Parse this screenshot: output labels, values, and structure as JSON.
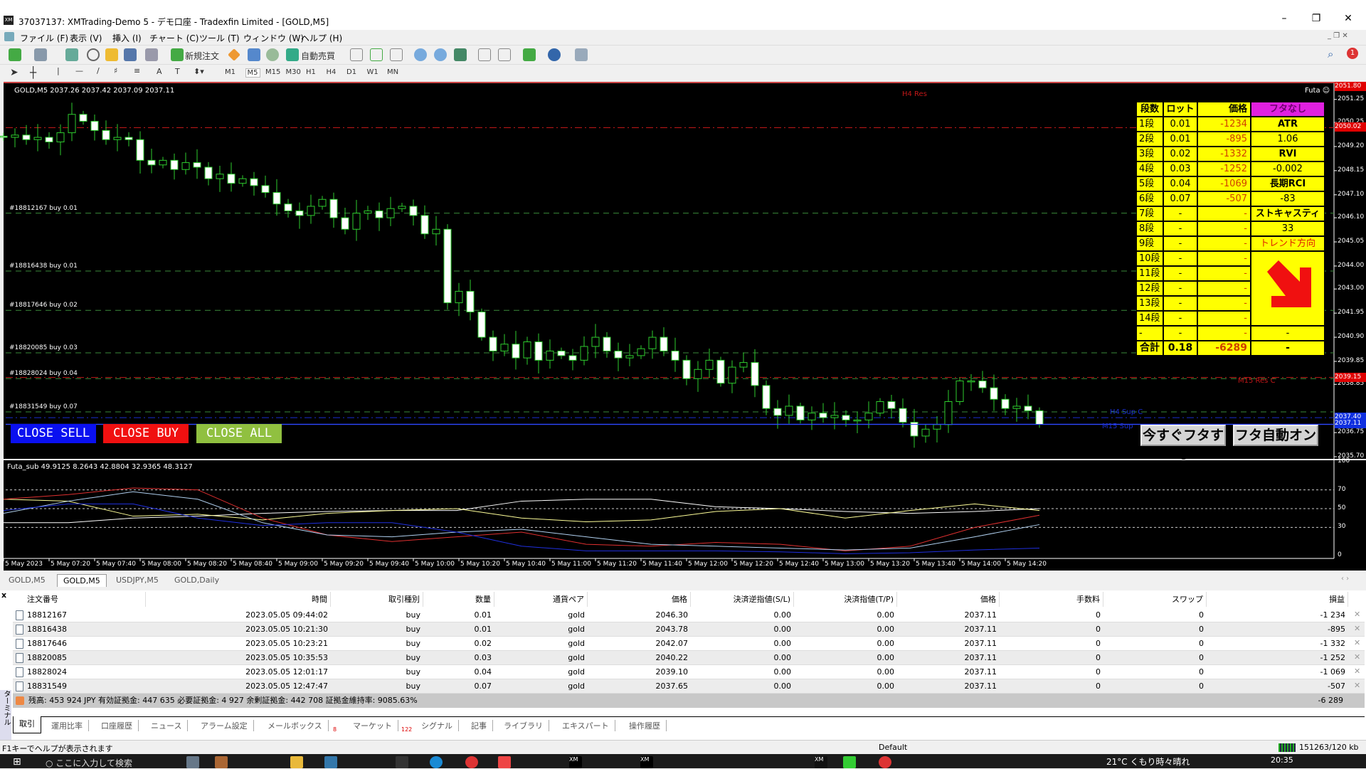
{
  "window": {
    "title": "37037137: XMTrading-Demo 5 - デモ口座 - Tradexfin Limited - [GOLD,M5]",
    "minimize": "–",
    "restore": "❐",
    "close": "✕"
  },
  "menu": [
    "ファイル (F)",
    "表示 (V)",
    "挿入 (I)",
    "チャート (C)",
    "ツール (T)",
    "ウィンドウ (W)",
    "ヘルプ (H)"
  ],
  "toolbar": {
    "new_order": "新規注文",
    "auto_trade": "自動売買",
    "timeframes": [
      "M1",
      "M5",
      "M15",
      "M30",
      "H1",
      "H4",
      "D1",
      "W1",
      "MN"
    ],
    "active_timeframe": "M5",
    "notification_count": "1"
  },
  "chart": {
    "header": "GOLD,M5  2037.26 2037.42 2037.09 2037.11",
    "indicator_name": "Futa",
    "price_axis": [
      "2051.25",
      "2050.25",
      "2049.20",
      "2048.15",
      "2047.10",
      "2046.10",
      "2045.05",
      "2044.00",
      "2043.00",
      "2041.95",
      "2040.90",
      "2039.85",
      "2038.85",
      "2036.75",
      "2035.70"
    ],
    "price_tags": [
      {
        "label": "2051.80",
        "color": "#e00000"
      },
      {
        "label": "2050.02",
        "color": "#e00000"
      },
      {
        "label": "2039.15",
        "color": "#e00000"
      },
      {
        "label": "2037.40",
        "color": "#1030e0"
      },
      {
        "label": "2037.11",
        "color": "#1030e0"
      }
    ],
    "levels": [
      {
        "label": "H4 Res",
        "price": 2050.02,
        "color": "#c01818"
      },
      {
        "label": "M15 Res C",
        "price": 2039.15,
        "color": "#c01818"
      },
      {
        "label": "H4 Sup C",
        "price": 2037.4,
        "color": "#1a2fd0"
      },
      {
        "label": "M15 Sup",
        "price": 2037.11,
        "color": "#1a2fd0"
      }
    ],
    "orders": [
      {
        "label": "#18812167 buy 0.01",
        "price": 2046.3
      },
      {
        "label": "#18816438 buy 0.01",
        "price": 2043.78
      },
      {
        "label": "#18817646 buy 0.02",
        "price": 2042.07
      },
      {
        "label": "#18820085 buy 0.03",
        "price": 2040.22
      },
      {
        "label": "#18828024 buy 0.04",
        "price": 2039.1
      },
      {
        "label": "#18831549 buy 0.07",
        "price": 2037.65
      }
    ],
    "closes": [
      2049.6,
      2049.7,
      2049.5,
      2049.6,
      2049.4,
      2049.8,
      2050.6,
      2050.3,
      2049.9,
      2049.5,
      2049.6,
      2049.5,
      2048.6,
      2048.4,
      2048.6,
      2048.2,
      2048.5,
      2048.3,
      2047.8,
      2048.0,
      2047.6,
      2047.8,
      2047.5,
      2047.2,
      2046.7,
      2046.4,
      2046.2,
      2046.6,
      2046.9,
      2046.1,
      2045.6,
      2046.3,
      2046.4,
      2046.1,
      2046.5,
      2046.6,
      2046.2,
      2045.4,
      2045.6,
      2042.4,
      2042.9,
      2042.0,
      2040.9,
      2040.3,
      2040.6,
      2040.0,
      2040.7,
      2039.9,
      2040.3,
      2040.1,
      2039.9,
      2040.5,
      2040.9,
      2040.3,
      2040.0,
      2040.1,
      2040.4,
      2040.9,
      2040.3,
      2039.9,
      2039.1,
      2039.5,
      2039.9,
      2038.9,
      2039.6,
      2039.8,
      2038.8,
      2037.8,
      2037.5,
      2037.9,
      2037.3,
      2037.6,
      2037.4,
      2037.5,
      2037.3,
      2037.3,
      2037.6,
      2038.1,
      2037.8,
      2037.2,
      2036.6,
      2036.9,
      2037.1,
      2038.1,
      2039.0,
      2039.0,
      2038.7,
      2038.2,
      2037.8,
      2037.9,
      2037.7,
      2037.11
    ],
    "buttons": {
      "close_sell": "CLOSE SELL",
      "close_buy": "CLOSE BUY",
      "close_all": "CLOSE ALL",
      "futa_now": "今すぐフタする",
      "futa_auto": "フタ自動オン"
    },
    "button_colors": {
      "close_sell": "#0a10f0",
      "close_buy": "#f01010",
      "close_all": "#90c040"
    },
    "sub": {
      "header": "Futa_sub 49.9125 8.2643 42.8804 32.9365 48.3127",
      "axis": [
        "100",
        "70",
        "50",
        "30",
        "0"
      ],
      "lines": [
        {
          "color": "#ffffff",
          "values": [
            35,
            35,
            40,
            42,
            45,
            47,
            48,
            48,
            58,
            60,
            60,
            52,
            50,
            47,
            45,
            47,
            50
          ]
        },
        {
          "color": "#ffff99",
          "values": [
            60,
            58,
            42,
            44,
            38,
            45,
            48,
            50,
            40,
            36,
            38,
            47,
            50,
            40,
            48,
            55,
            48
          ]
        },
        {
          "color": "#e03030",
          "values": [
            60,
            65,
            72,
            70,
            40,
            22,
            15,
            20,
            25,
            12,
            10,
            14,
            12,
            5,
            10,
            30,
            43
          ]
        },
        {
          "color": "#b0d0f0",
          "values": [
            45,
            58,
            68,
            60,
            35,
            22,
            20,
            25,
            28,
            20,
            12,
            10,
            8,
            6,
            8,
            20,
            33
          ]
        },
        {
          "color": "#2030e0",
          "values": [
            48,
            55,
            55,
            40,
            32,
            35,
            35,
            25,
            10,
            5,
            5,
            5,
            4,
            2,
            3,
            6,
            8
          ]
        }
      ]
    },
    "time_axis": [
      "5 May 2023",
      "5 May 07:20",
      "5 May 07:40",
      "5 May 08:00",
      "5 May 08:20",
      "5 May 08:40",
      "5 May 09:00",
      "5 May 09:20",
      "5 May 09:40",
      "5 May 10:00",
      "5 May 10:20",
      "5 May 10:40",
      "5 May 11:00",
      "5 May 11:20",
      "5 May 11:40",
      "5 May 12:00",
      "5 May 12:20",
      "5 May 12:40",
      "5 May 13:00",
      "5 May 13:20",
      "5 May 13:40",
      "5 May 14:00",
      "5 May 14:20"
    ]
  },
  "futa_panel": {
    "headers": [
      "段数",
      "ロット",
      "価格",
      "フタなし"
    ],
    "rows": [
      [
        "1段",
        "0.01",
        "-1234",
        "ATR"
      ],
      [
        "2段",
        "0.01",
        "-895",
        "1.06"
      ],
      [
        "3段",
        "0.02",
        "-1332",
        "RVI"
      ],
      [
        "4段",
        "0.03",
        "-1252",
        "-0.002"
      ],
      [
        "5段",
        "0.04",
        "-1069",
        "長期RCI"
      ],
      [
        "6段",
        "0.07",
        "-507",
        "-83"
      ],
      [
        "7段",
        "-",
        "-",
        "ストキャスティクス"
      ],
      [
        "8段",
        "-",
        "-",
        "33"
      ],
      [
        "9段",
        "-",
        "-",
        "トレンド方向"
      ],
      [
        "10段",
        "-",
        "-",
        ""
      ],
      [
        "11段",
        "-",
        "-",
        ""
      ],
      [
        "12段",
        "-",
        "-",
        ""
      ],
      [
        "13段",
        "-",
        "-",
        ""
      ],
      [
        "14段",
        "-",
        "-",
        ""
      ],
      [
        "-",
        "-",
        "-",
        "-"
      ]
    ],
    "total": [
      "合計",
      "0.18",
      "-6289",
      "-"
    ],
    "trend": "down"
  },
  "chart_tabs": [
    "GOLD,M5",
    "GOLD,M5",
    "USDJPY,M5",
    "GOLD,Daily"
  ],
  "terminal": {
    "columns": [
      "注文番号",
      "時間",
      "取引種別",
      "数量",
      "通貨ペア",
      "価格",
      "決済逆指値(S/L)",
      "決済指値(T/P)",
      "価格",
      "手数料",
      "スワップ",
      "損益"
    ],
    "rows": [
      [
        "18812167",
        "2023.05.05 09:44:02",
        "buy",
        "0.01",
        "gold",
        "2046.30",
        "0.00",
        "0.00",
        "2037.11",
        "0",
        "0",
        "-1 234"
      ],
      [
        "18816438",
        "2023.05.05 10:21:30",
        "buy",
        "0.01",
        "gold",
        "2043.78",
        "0.00",
        "0.00",
        "2037.11",
        "0",
        "0",
        "-895"
      ],
      [
        "18817646",
        "2023.05.05 10:23:21",
        "buy",
        "0.02",
        "gold",
        "2042.07",
        "0.00",
        "0.00",
        "2037.11",
        "0",
        "0",
        "-1 332"
      ],
      [
        "18820085",
        "2023.05.05 10:35:53",
        "buy",
        "0.03",
        "gold",
        "2040.22",
        "0.00",
        "0.00",
        "2037.11",
        "0",
        "0",
        "-1 252"
      ],
      [
        "18828024",
        "2023.05.05 12:01:17",
        "buy",
        "0.04",
        "gold",
        "2039.10",
        "0.00",
        "0.00",
        "2037.11",
        "0",
        "0",
        "-1 069"
      ],
      [
        "18831549",
        "2023.05.05 12:47:47",
        "buy",
        "0.07",
        "gold",
        "2037.65",
        "0.00",
        "0.00",
        "2037.11",
        "0",
        "0",
        "-507"
      ]
    ],
    "summary": "残高: 453 924 JPY  有効証拠金: 447 635  必要証拠金: 4 927  余剰証拠金: 442 708  証拠金維持率: 9085.63%",
    "total": "-6 289",
    "side_label": "ターミナル",
    "tabs": [
      "取引",
      "運用比率",
      "口座履歴",
      "ニュース",
      "アラーム設定",
      "メールボックス",
      "マーケット",
      "シグナル",
      "記事",
      "ライブラリ",
      "エキスパート",
      "操作履歴"
    ],
    "mailbox_count": "8",
    "market_count": "122"
  },
  "status": {
    "help": "F1キーでヘルプが表示されます",
    "profile": "Default",
    "traffic": "151263/120 kb"
  },
  "taskbar": {
    "search": "ここに入力して検索",
    "weather": "21°C  くもり時々晴れ",
    "time": "20:35"
  }
}
